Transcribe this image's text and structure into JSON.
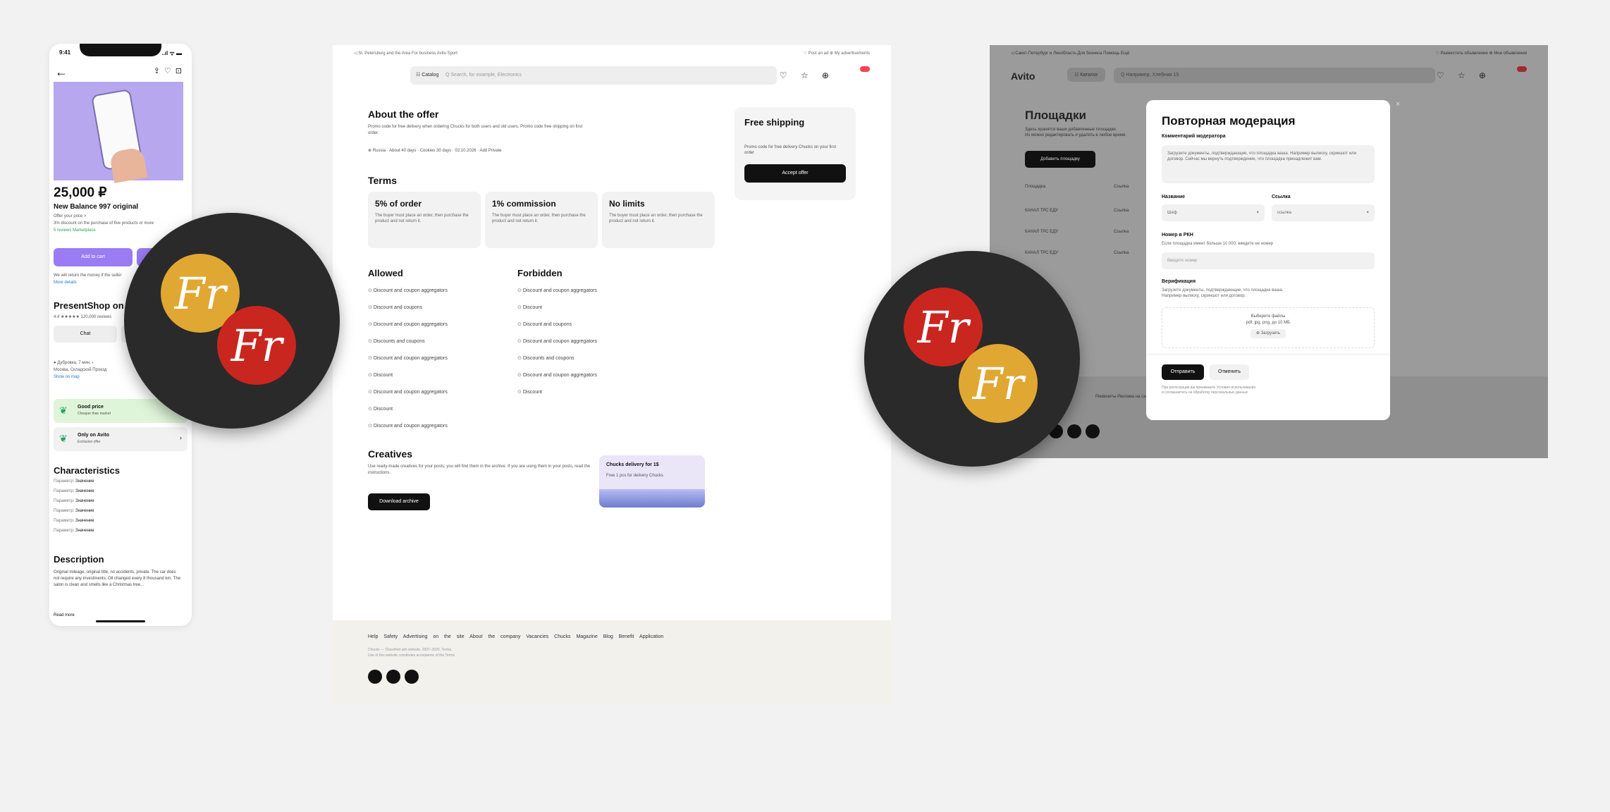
{
  "phone": {
    "time": "9:41",
    "signal": "..ıl ᯤ ▬",
    "price": "25,000 ₽",
    "product_name": "New Balance 997 original",
    "lines": [
      "Offer your price >",
      "3% discount on the purchase of five products or more",
      "5 reviews  Marketplace"
    ],
    "add_to_cart": "Add to cart",
    "buy_note": [
      "We will return the money if the seller",
      "More details"
    ],
    "shop_name": "PresentShop on",
    "shop_rating": "4.4 ★★★★★ 120,000 reviews",
    "chat_btn": "Chat",
    "seller_info": [
      "● Дубровка, 7 мин. ›",
      "Москва, Складской Проезд",
      "Show on map"
    ],
    "good_price_title": "Good price",
    "good_price_sub": "Cheaper than market",
    "only_title": "Only on Avito",
    "only_sub": "Exclusive offer",
    "characteristics_title": "Characteristics",
    "characteristics": [
      {
        "k": "Параметр",
        "v": "Значение"
      },
      {
        "k": "Параметр",
        "v": "Значение"
      },
      {
        "k": "Параметр",
        "v": "Значение"
      },
      {
        "k": "Параметр",
        "v": "Значение"
      },
      {
        "k": "Параметр",
        "v": "Значение"
      },
      {
        "k": "Параметр",
        "v": "Значение"
      }
    ],
    "description_title": "Description",
    "description": "Original mileage, original title, no accidents, private. The car does not require any investments. Oil changed every 8 thousand km. The salon is clean and smells like a Christmas tree...",
    "read_more": "Read more"
  },
  "center": {
    "top_left": "◁ St. Petersburg and the Area   For business   Avito   Sport",
    "top_right": "♡ Post an ad   ⊕ My advertisements",
    "catalog": "☷ Catalog",
    "search_placeholder": "Q  Search, for example, Electronics",
    "header_icons": "♡ ☆ ⊕",
    "about_title": "About the offer",
    "about_text": "Promo code for free delivery when ordering Chucks for both users and old users. Promo code free shipping on first order.",
    "about_meta": "⊕ Russia · About 40 days · Cookies 30 days · 02.10.2026 · Add Private",
    "terms_title": "Terms",
    "terms": [
      {
        "title": "5% of order",
        "text": "The buyer must place an order, then purchase the product and not return it."
      },
      {
        "title": "1% commission",
        "text": "The buyer must place an order, then purchase the product and not return it."
      },
      {
        "title": "No limits",
        "text": "The buyer must place an order, then purchase the product and not return it."
      }
    ],
    "aside_title": "Free shipping",
    "aside_text": "Promo code for free delivery Chucks on your first order",
    "aside_button": "Accept offer",
    "allowed_title": "Allowed",
    "allowed": [
      "Discount and coupon aggregators",
      "Discount and coupons",
      "Discount and coupon aggregators",
      "Discounts and coupons",
      "Discount and coupon aggregators",
      "Discount",
      "Discount and coupon aggregators",
      "Discount",
      "Discount and coupon aggregators"
    ],
    "forbidden_title": "Forbidden",
    "forbidden": [
      "Discount and coupon aggregators",
      "Discount",
      "Discount and coupons",
      "Discount and coupon aggregators",
      "Discounts and coupons",
      "Discount and coupon aggregators",
      "Discount"
    ],
    "creatives_title": "Creatives",
    "creatives_text": "Use ready-made creatives for your posts; you will find them in the archive. If you are using them in your posts, read the instructions.",
    "creatives_button": "Download archive",
    "creative_card_title": "Chucks delivery for 1$",
    "creative_card_sub": "Free 1 pcs for delivery Chucks",
    "footer_links": "Help Safety Advertising on the site About the company Vacancies Chucks Magazine Blog Benefit Application",
    "footer_copy": [
      "Chucks — Classified ads website. 2007–2026. Terms.",
      "Use of this website constitutes acceptance of the Terms"
    ]
  },
  "right": {
    "top_left": "◁ Санкт-Петербург и Ленобласть   Для бизнеса   Помощь   Ещё",
    "top_right": "♡ Разместить объявление   ⊕ Мои объявления",
    "logo": "Avito",
    "catalog": "☷ Каталог",
    "search_placeholder": "Q  Например, Хлебная 15",
    "header_icons": "♡ ☆ ⊕",
    "page_title": "Площадки",
    "page_text": [
      "Здесь хранятся ваши добавленные площадки.",
      "Их можно редактировать и удалять в любое время."
    ],
    "add_button": "Добавить площадку",
    "col1": "Площадка",
    "col2": "Ссылка",
    "rows": [
      {
        "a": "КАНАЛ ТРС ЕДУ",
        "b": "Ссылка"
      },
      {
        "a": "КАНАЛ ТРС ЕДУ",
        "b": "Ссылка"
      },
      {
        "a": "КАНАЛ ТРС ЕДУ",
        "b": "Ссылка"
      }
    ],
    "bottom_text": "Реквизиты   Реклама на сайте",
    "modal": {
      "title": "Повторная модерация",
      "comment_label": "Комментарий модератора",
      "comment_text": "Загрузите документы, подтверждающие, что площадка ваша. Например выписку, скриншот или договор. Сейчас мы вернуть подтверждение, что площадка принадлежит вам.",
      "name_label": "Название",
      "name_value": "Шеф",
      "link_label": "Ссылка",
      "link_value": "ссылка",
      "rkn_label": "Номер в РКН",
      "rkn_sub": "Если площадка имеет больше 10 000, введите ее номер",
      "rkn_placeholder": "Введите номер",
      "verify_label": "Верификация",
      "verify_sub": [
        "Загрузите документы, подтверждающие, что площадка ваша.",
        "Например выписку, скриншот или договор."
      ],
      "drop_title": "Выберите файлы",
      "drop_sub": "pdf, jpg, png, до 10 МБ",
      "drop_button": "⊕ Загрузить",
      "send": "Отправить",
      "cancel": "Отменить",
      "note": [
        "При регистрации вы принимаете Условия использования",
        "и соглашаетесь на обработку персональных данных"
      ]
    }
  },
  "logos": {
    "mark": "Fr",
    "yellow": "#e0a733",
    "red": "#c9261f",
    "bg": "#2a2a2a"
  }
}
